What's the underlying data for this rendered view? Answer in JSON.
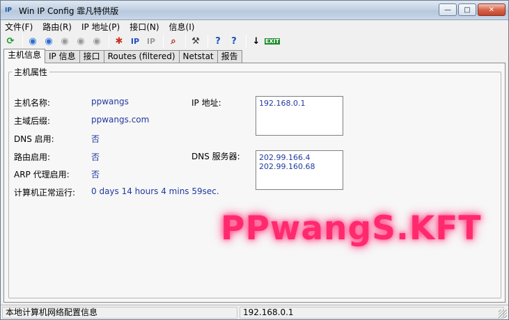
{
  "window": {
    "title": "Win IP Config 霏凡特供版",
    "app_icon_text": "IP",
    "buttons": {
      "minimize": "—",
      "maximize": "□",
      "close": "✕"
    }
  },
  "menu": [
    {
      "label": "文件(F)"
    },
    {
      "label": "路由(R)"
    },
    {
      "label": "IP 地址(P)"
    },
    {
      "label": "接口(N)"
    },
    {
      "label": "信息(I)"
    }
  ],
  "toolbar": [
    {
      "icon": "refresh-icon",
      "glyph": "⟳",
      "color": "#1a9a2a"
    },
    {
      "sep": true
    },
    {
      "icon": "network-globe-icon",
      "glyph": "◉",
      "color": "#2a6fd0"
    },
    {
      "icon": "router-icon",
      "glyph": "◉",
      "color": "#2a6fd0"
    },
    {
      "icon": "router-disabled-icon",
      "glyph": "◉",
      "color": "#9a9a9a"
    },
    {
      "icon": "router-disabled-2-icon",
      "glyph": "◉",
      "color": "#9a9a9a"
    },
    {
      "icon": "router-disabled-3-icon",
      "glyph": "◉",
      "color": "#9a9a9a"
    },
    {
      "sep": true
    },
    {
      "icon": "interface-icon",
      "glyph": "✱",
      "color": "#c8321e"
    },
    {
      "icon": "ip-icon",
      "glyph": "IP",
      "color": "#1f4fc0"
    },
    {
      "icon": "ip-disabled-icon",
      "glyph": "IP",
      "color": "#9a9a9a"
    },
    {
      "sep": true
    },
    {
      "icon": "search-icon",
      "glyph": "⌕",
      "color": "#b0201a"
    },
    {
      "sep": true
    },
    {
      "icon": "tools-icon",
      "glyph": "⚒",
      "color": "#333333"
    },
    {
      "sep": true
    },
    {
      "icon": "help-icon",
      "glyph": "?",
      "color": "#1f4fc0"
    },
    {
      "icon": "context-help-icon",
      "glyph": "?",
      "color": "#1f4fc0"
    },
    {
      "sep": true
    },
    {
      "icon": "pointer-icon",
      "glyph": "↓",
      "color": "#000000"
    },
    {
      "icon": "exit-icon",
      "glyph": "EXIT",
      "color": "#1a8a2a"
    }
  ],
  "tabs": [
    {
      "label": "主机信息",
      "active": true
    },
    {
      "label": "IP 信息",
      "active": false
    },
    {
      "label": "接口",
      "active": false
    },
    {
      "label": "Routes (filtered)",
      "active": false
    },
    {
      "label": "Netstat",
      "active": false
    },
    {
      "label": "报告",
      "active": false
    }
  ],
  "host": {
    "group_title": "主机属性",
    "hostname_label": "主机名称:",
    "hostname_value": "ppwangs",
    "domain_label": "主域后缀:",
    "domain_value": "ppwangs.com",
    "dns_enabled_label": "DNS 启用:",
    "dns_enabled_value": "否",
    "routing_label": "路由启用:",
    "routing_value": "否",
    "arp_proxy_label": "ARP 代理启用:",
    "arp_proxy_value": "否",
    "uptime_label": "计算机正常运行:",
    "uptime_value": "0 days 14 hours 4 mins 59sec.",
    "ip_label": "IP 地址:",
    "ip_list": [
      "192.168.0.1"
    ],
    "dns_servers_label": "DNS 服务器:",
    "dns_list": [
      "202.99.166.4",
      "202.99.160.68"
    ]
  },
  "watermark": "PPwangS.KFT",
  "status": {
    "left": "本地计算机网络配置信息",
    "right": "192.168.0.1"
  },
  "colors": {
    "value_text": "#1f3a9e",
    "watermark": "#ff2a6e"
  }
}
